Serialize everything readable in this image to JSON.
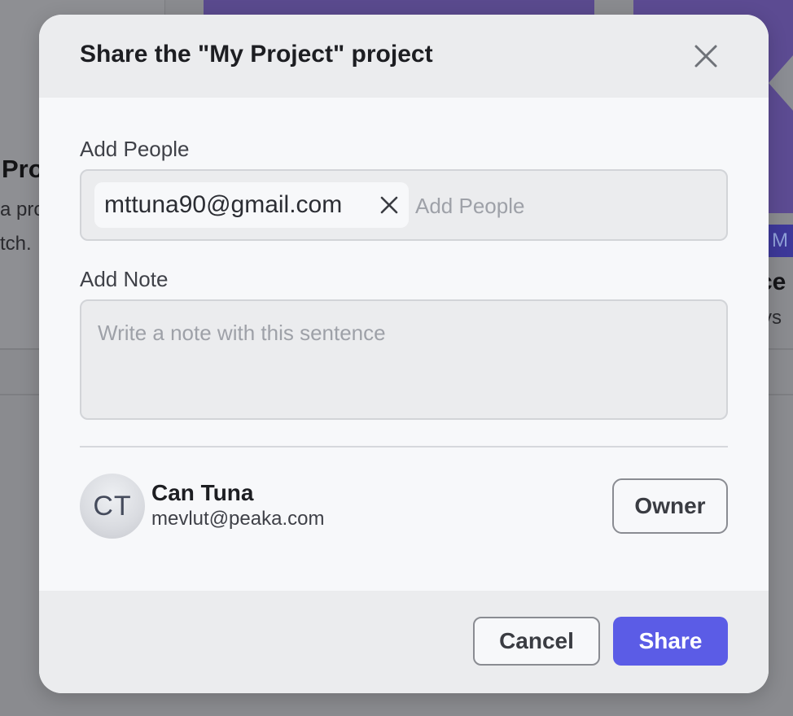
{
  "background": {
    "left_card": {
      "title": "Pro",
      "line1": "a pro",
      "line2": "tch."
    },
    "right_card": {
      "badge": "n M",
      "title": "ce",
      "subtitle": "ys"
    }
  },
  "dialog": {
    "title": "Share the \"My Project\" project",
    "close_icon": "close-icon",
    "add_people": {
      "label": "Add People",
      "chips": [
        "mttuna90@gmail.com"
      ],
      "placeholder": "Add People"
    },
    "add_note": {
      "label": "Add Note",
      "placeholder": "Write a note with this sentence"
    },
    "member": {
      "initials": "CT",
      "name": "Can Tuna",
      "email": "mevlut@peaka.com",
      "role": "Owner"
    },
    "footer": {
      "cancel_label": "Cancel",
      "share_label": "Share"
    }
  },
  "colors": {
    "primary": "#5b5ce6",
    "overlay": "#8a8b8f",
    "dialog_bg": "#f7f8fa",
    "dialog_header_bg": "#ebecee"
  }
}
